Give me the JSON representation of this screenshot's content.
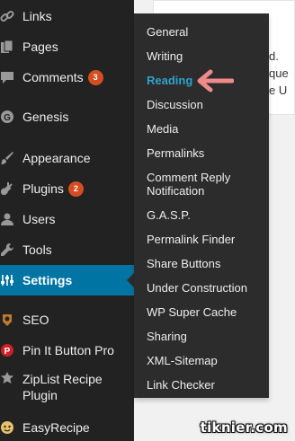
{
  "content": {
    "title_fragment": "er",
    "lines": [
      "d.",
      "que",
      "e U"
    ]
  },
  "sidebar": {
    "items": [
      {
        "label": "Links",
        "icon": "link-icon"
      },
      {
        "label": "Pages",
        "icon": "pages-icon"
      },
      {
        "label": "Comments",
        "icon": "comment-icon",
        "badge": "3"
      },
      {
        "label": "Genesis",
        "icon": "genesis-icon"
      },
      {
        "label": "Appearance",
        "icon": "paintbrush-icon"
      },
      {
        "label": "Plugins",
        "icon": "plugin-icon",
        "badge": "2"
      },
      {
        "label": "Users",
        "icon": "user-icon"
      },
      {
        "label": "Tools",
        "icon": "wrench-icon"
      },
      {
        "label": "Settings",
        "icon": "settings-sliders-icon",
        "current": true
      },
      {
        "label": "SEO",
        "icon": "seo-icon"
      },
      {
        "label": "Pin It Button Pro",
        "icon": "pinterest-icon"
      },
      {
        "label": "ZipList Recipe Plugin",
        "icon": "ziplist-icon"
      },
      {
        "label": "EasyRecipe",
        "icon": "easyrecipe-icon"
      }
    ]
  },
  "submenu": {
    "items": [
      {
        "label": "General"
      },
      {
        "label": "Writing"
      },
      {
        "label": "Reading",
        "active": true
      },
      {
        "label": "Discussion"
      },
      {
        "label": "Media"
      },
      {
        "label": "Permalinks"
      },
      {
        "label": "Comment Reply Notification"
      },
      {
        "label": "G.A.S.P."
      },
      {
        "label": "Permalink Finder"
      },
      {
        "label": "Share Buttons"
      },
      {
        "label": "Under Construction"
      },
      {
        "label": "WP Super Cache"
      },
      {
        "label": "Sharing"
      },
      {
        "label": "XML-Sitemap"
      },
      {
        "label": "Link Checker"
      }
    ]
  },
  "watermark": "tiknier.com",
  "colors": {
    "sidebar_bg": "#222222",
    "submenu_bg": "#2c2c2c",
    "current_bg": "#0074a2",
    "active_link": "#2ea2cc",
    "badge": "#d54e21",
    "arrow": "#f08a8a"
  }
}
